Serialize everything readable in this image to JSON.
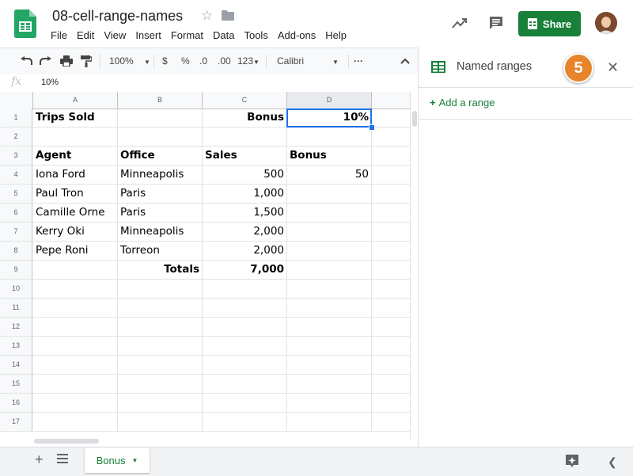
{
  "header": {
    "doc_title": "08-cell-range-names",
    "menu": [
      "File",
      "Edit",
      "View",
      "Insert",
      "Format",
      "Data",
      "Tools",
      "Add-ons",
      "Help"
    ],
    "share_label": "Share"
  },
  "toolbar": {
    "zoom": "100%",
    "currency": "$",
    "percent": "%",
    "decrease_decimal": ".0",
    "increase_decimal": ".00",
    "number_format": "123",
    "font": "Calibri",
    "more": "···"
  },
  "formula_bar": {
    "fx": "fx",
    "value": "10%"
  },
  "grid": {
    "columns": [
      "A",
      "B",
      "C",
      "D"
    ],
    "row_numbers": [
      "1",
      "2",
      "3",
      "4",
      "5",
      "6",
      "7",
      "8",
      "9",
      "10",
      "11",
      "12",
      "13",
      "14",
      "15",
      "16",
      "17"
    ],
    "cells": {
      "r1": {
        "a": "Trips Sold",
        "c": "Bonus",
        "d": "10%"
      },
      "r3": {
        "a": "Agent",
        "b": "Office",
        "c": "Sales",
        "d": "Bonus"
      },
      "r4": {
        "a": "Iona Ford",
        "b": "Minneapolis",
        "c": "500",
        "d": "50"
      },
      "r5": {
        "a": "Paul Tron",
        "b": "Paris",
        "c": "1,000"
      },
      "r6": {
        "a": "Camille Orne",
        "b": "Paris",
        "c": "1,500"
      },
      "r7": {
        "a": "Kerry Oki",
        "b": "Minneapolis",
        "c": "2,000"
      },
      "r8": {
        "a": "Pepe Roni",
        "b": "Torreon",
        "c": "2,000"
      },
      "r9": {
        "b": "Totals",
        "c": "7,000"
      }
    }
  },
  "panel": {
    "title": "Named ranges",
    "step_number": "5",
    "add_range": "Add a range"
  },
  "sheets": {
    "active_tab": "Bonus"
  },
  "colors": {
    "brand_green": "#188038",
    "selection_blue": "#1a73e8",
    "step_orange": "#e8852c"
  }
}
